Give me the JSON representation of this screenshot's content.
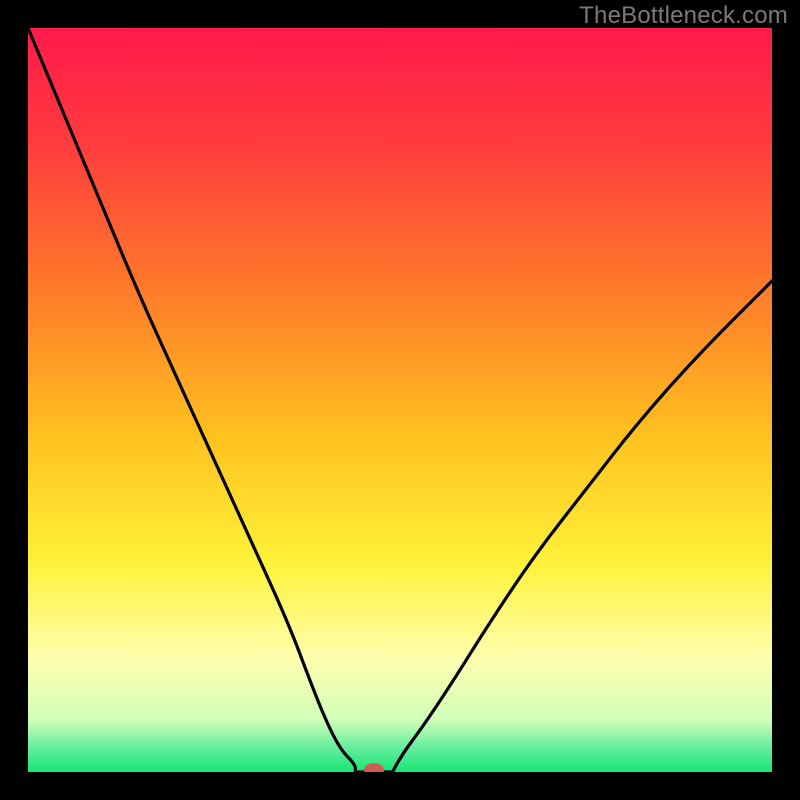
{
  "watermark": "TheBottleneck.com",
  "chart_data": {
    "type": "line",
    "title": "",
    "xlabel": "",
    "ylabel": "",
    "xlim": [
      0,
      100
    ],
    "ylim": [
      0,
      100
    ],
    "grid": false,
    "legend": false,
    "annotations": [],
    "gradient_stops": [
      {
        "offset": 0.0,
        "color": "#ff1a4b"
      },
      {
        "offset": 0.15,
        "color": "#ff3a3e"
      },
      {
        "offset": 0.35,
        "color": "#ff7a2a"
      },
      {
        "offset": 0.55,
        "color": "#ffc21f"
      },
      {
        "offset": 0.72,
        "color": "#fff23a"
      },
      {
        "offset": 0.85,
        "color": "#fdffb0"
      },
      {
        "offset": 0.93,
        "color": "#d0ffb8"
      },
      {
        "offset": 0.965,
        "color": "#6beea0"
      },
      {
        "offset": 1.0,
        "color": "#17e676"
      }
    ],
    "series": [
      {
        "name": "bottleneck-curve",
        "x": [
          0,
          5,
          10,
          15,
          20,
          25,
          30,
          35,
          38,
          40,
          42,
          44,
          46,
          48,
          50,
          53,
          57,
          62,
          68,
          75,
          82,
          90,
          100
        ],
        "values": [
          100,
          88,
          76,
          64,
          53,
          42,
          31,
          20,
          12,
          7,
          3,
          1,
          0,
          0,
          2,
          6,
          12,
          20,
          29,
          38,
          47,
          56,
          66
        ]
      }
    ],
    "marker": {
      "x": 46.5,
      "y": 0,
      "color": "#cc5c54",
      "rx": 10,
      "ry": 7
    },
    "flat_segment": {
      "x_start": 44,
      "x_end": 49,
      "y": 0
    }
  }
}
